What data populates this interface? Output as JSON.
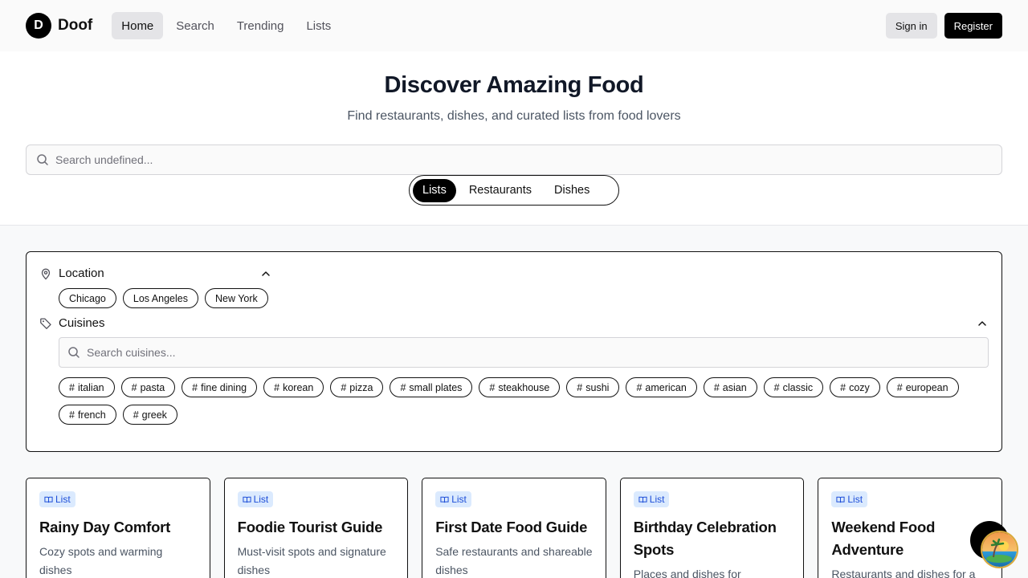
{
  "brand": {
    "logo_letter": "D",
    "name": "Doof"
  },
  "nav": [
    {
      "label": "Home",
      "active": true
    },
    {
      "label": "Search",
      "active": false
    },
    {
      "label": "Trending",
      "active": false
    },
    {
      "label": "Lists",
      "active": false
    }
  ],
  "auth": {
    "signin": "Sign in",
    "register": "Register"
  },
  "hero": {
    "title": "Discover Amazing Food",
    "subtitle": "Find restaurants, dishes, and curated lists from food lovers",
    "search_placeholder": "Search undefined...",
    "segments": [
      "Lists",
      "Restaurants",
      "Dishes"
    ],
    "active_segment": "Lists"
  },
  "filters": {
    "location": {
      "label": "Location",
      "options": [
        "Chicago",
        "Los Angeles",
        "New York"
      ]
    },
    "cuisines": {
      "label": "Cuisines",
      "search_placeholder": "Search cuisines...",
      "tags": [
        "italian",
        "pasta",
        "fine dining",
        "korean",
        "pizza",
        "small plates",
        "steakhouse",
        "sushi",
        "american",
        "asian",
        "classic",
        "cozy",
        "european",
        "french",
        "greek"
      ]
    }
  },
  "cards": [
    {
      "badge": "List",
      "title": "Rainy Day Comfort",
      "desc": "Cozy spots and warming dishes"
    },
    {
      "badge": "List",
      "title": "Foodie Tourist Guide",
      "desc": "Must-visit spots and signature dishes"
    },
    {
      "badge": "List",
      "title": "First Date Food Guide",
      "desc": "Safe restaurants and shareable dishes"
    },
    {
      "badge": "List",
      "title": "Birthday Celebration Spots",
      "desc": "Places and dishes for"
    },
    {
      "badge": "List",
      "title": "Weekend Food Adventure",
      "desc": "Restaurants and dishes for a"
    }
  ],
  "colors": {
    "accent": "#000000",
    "badge_bg": "#dbeafe",
    "badge_fg": "#1d4ed8"
  },
  "icons": {
    "search": "search-icon",
    "location": "map-pin-icon",
    "cuisines": "tag-icon",
    "collapse": "chevron-up-icon",
    "list": "book-open-icon"
  }
}
